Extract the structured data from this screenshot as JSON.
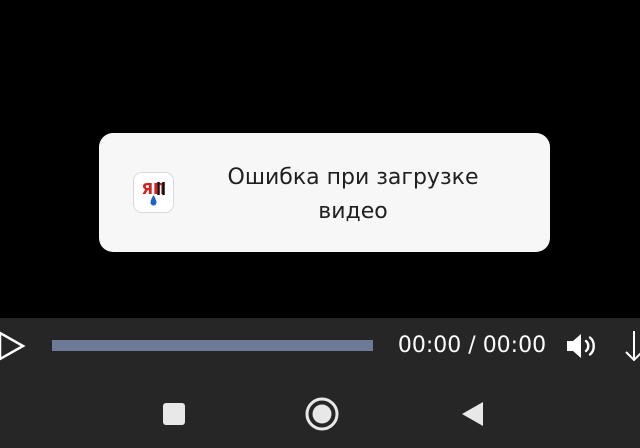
{
  "toast": {
    "app_icon": "yap-app-icon",
    "app_icon_text": "ЯП",
    "message_line1": "Ошибка при загрузке",
    "message_line2": "видео",
    "background": "#f7f7f7"
  },
  "player": {
    "play_icon": "play-icon",
    "time_readout": "00:00 / 00:00",
    "progress": 0,
    "volume_icon": "volume-icon",
    "download_icon": "download-icon",
    "seek_color": "#6c7a98"
  },
  "navigation": {
    "recent_icon": "recent-apps-icon",
    "home_icon": "home-icon",
    "back_icon": "back-icon",
    "background": "#262626"
  }
}
